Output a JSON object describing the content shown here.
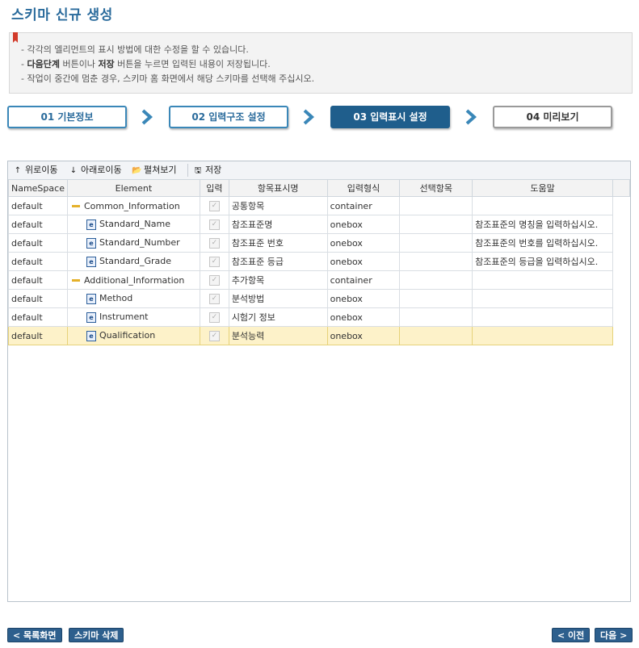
{
  "page": {
    "title": "스키마 신규 생성"
  },
  "notice": {
    "line1": "- 각각의 엘리먼트의 표시 방법에 대한 수정을 할 수 있습니다.",
    "line2_prefix": "- ",
    "line2_bold1": "다음단계",
    "line2_mid": " 버튼이나 ",
    "line2_bold2": "저장",
    "line2_suffix": " 버튼을 누르면 입력된 내용이 저장됩니다.",
    "line3": "- 작업이 중간에 멈춘 경우, 스키마 홈 화면에서 해당 스키마를 선택해 주십시오."
  },
  "steps": [
    {
      "label": "01 기본정보"
    },
    {
      "label": "02 입력구조 설정"
    },
    {
      "label": "03 입력표시 설정"
    },
    {
      "label": "04 미리보기"
    }
  ],
  "toolbar": {
    "move_up": "위로이동",
    "move_down": "아래로이동",
    "expand": "펼쳐보기",
    "save": "저장"
  },
  "columns": [
    "NameSpace",
    "Element",
    "입력",
    "항목표시명",
    "입력형식",
    "선택항목",
    "도움말"
  ],
  "rows": [
    {
      "ns": "default",
      "element": "Common_Information",
      "kind": "group",
      "checked": true,
      "display": "공통항목",
      "format": "container",
      "options": "",
      "help": ""
    },
    {
      "ns": "default",
      "element": "Standard_Name",
      "kind": "element",
      "checked": true,
      "display": "참조표준명",
      "format": "onebox",
      "options": "",
      "help": "참조표준의 명칭을 입력하십시오."
    },
    {
      "ns": "default",
      "element": "Standard_Number",
      "kind": "element",
      "checked": true,
      "display": "참조표준 번호",
      "format": "onebox",
      "options": "",
      "help": "참조표준의 번호를 입력하십시오."
    },
    {
      "ns": "default",
      "element": "Standard_Grade",
      "kind": "element",
      "checked": true,
      "display": "참조표준 등급",
      "format": "onebox",
      "options": "",
      "help": "참조표준의 등급을 입력하십시오."
    },
    {
      "ns": "default",
      "element": "Additional_Information",
      "kind": "group",
      "checked": true,
      "display": "추가항목",
      "format": "container",
      "options": "",
      "help": ""
    },
    {
      "ns": "default",
      "element": "Method",
      "kind": "element",
      "checked": true,
      "display": "분석방법",
      "format": "onebox",
      "options": "",
      "help": ""
    },
    {
      "ns": "default",
      "element": "Instrument",
      "kind": "element",
      "checked": true,
      "display": "시험기 정보",
      "format": "onebox",
      "options": "",
      "help": ""
    },
    {
      "ns": "default",
      "element": "Qualification",
      "kind": "element",
      "checked": true,
      "display": "분석능력",
      "format": "onebox",
      "options": "",
      "help": ""
    }
  ],
  "footer": {
    "list_button": "< 목록화면",
    "delete_button": "스키마 삭제",
    "prev_button": "< 이전",
    "next_button": "다음 >"
  },
  "colors": {
    "accent": "#1f5e8c",
    "title": "#2a6b9c",
    "selected_row": "#fdf2c9"
  }
}
